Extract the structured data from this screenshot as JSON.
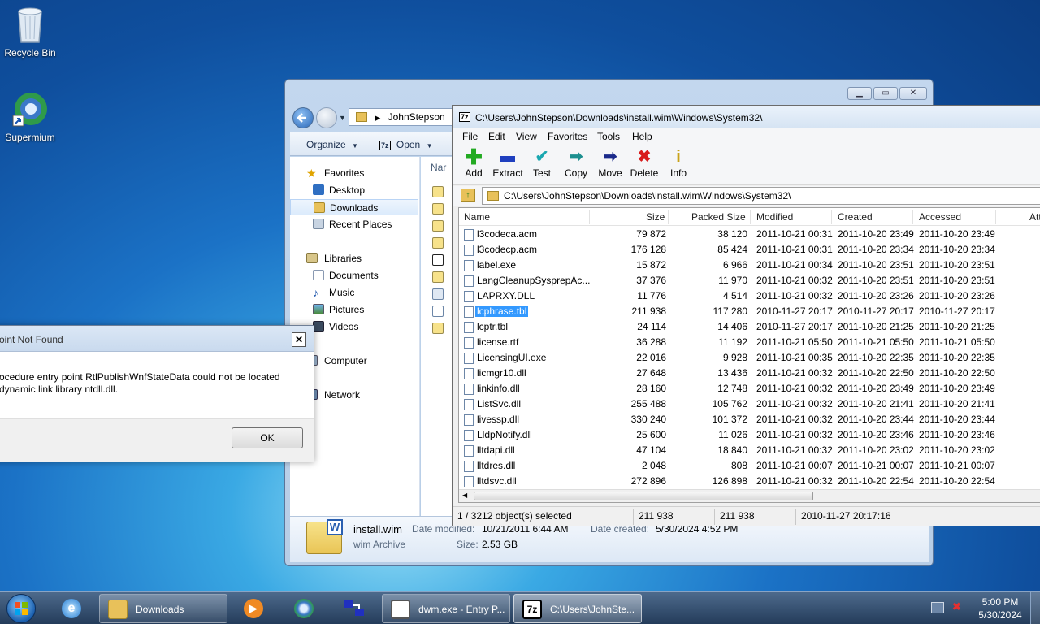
{
  "desktop": {
    "icons": [
      {
        "label": "Recycle Bin"
      },
      {
        "label": "Supermium"
      }
    ]
  },
  "explorer": {
    "breadcrumb": "JohnStepson",
    "toolbar": {
      "organize": "Organize",
      "open": "Open"
    },
    "nav": {
      "favorites": "Favorites",
      "desktop": "Desktop",
      "downloads": "Downloads",
      "recent": "Recent Places",
      "libraries": "Libraries",
      "documents": "Documents",
      "music": "Music",
      "pictures": "Pictures",
      "videos": "Videos",
      "computer": "Computer",
      "network": "Network"
    },
    "column_header_partial": "Nar",
    "details": {
      "file_name": "install.wim",
      "file_type": "wim Archive",
      "modified_label": "Date modified:",
      "modified_value": "10/21/2011 6:44 AM",
      "size_label": "Size:",
      "size_value": "2.53 GB",
      "created_label": "Date created:",
      "created_value": "5/30/2024 4:52 PM"
    }
  },
  "sevenzip": {
    "title": "C:\\Users\\JohnStepson\\Downloads\\install.wim\\Windows\\System32\\",
    "menu": [
      "File",
      "Edit",
      "View",
      "Favorites",
      "Tools",
      "Help"
    ],
    "tools": [
      {
        "label": "Add",
        "icon": "add-icon",
        "color": "#22aa22"
      },
      {
        "label": "Extract",
        "icon": "extract-icon",
        "color": "#1f3fbf"
      },
      {
        "label": "Test",
        "icon": "test-icon",
        "color": "#1aa7b0"
      },
      {
        "label": "Copy",
        "icon": "copy-icon",
        "color": "#1c8f8f"
      },
      {
        "label": "Move",
        "icon": "move-icon",
        "color": "#1a2a8a"
      },
      {
        "label": "Delete",
        "icon": "delete-icon",
        "color": "#d81b1b"
      },
      {
        "label": "Info",
        "icon": "info-icon",
        "color": "#c9a21a"
      }
    ],
    "address": "C:\\Users\\JohnStepson\\Downloads\\install.wim\\Windows\\System32\\",
    "columns": {
      "name": "Name",
      "size": "Size",
      "packed": "Packed Size",
      "modified": "Modified",
      "created": "Created",
      "accessed": "Accessed",
      "attr": "Att"
    },
    "files": [
      {
        "name": "l3codeca.acm",
        "size": "79 872",
        "packed": "38 120",
        "modified": "2011-10-21 00:31",
        "created": "2011-10-20 23:49",
        "accessed": "2011-10-20 23:49"
      },
      {
        "name": "l3codecp.acm",
        "size": "176 128",
        "packed": "85 424",
        "modified": "2011-10-21 00:31",
        "created": "2011-10-20 23:34",
        "accessed": "2011-10-20 23:34"
      },
      {
        "name": "label.exe",
        "size": "15 872",
        "packed": "6 966",
        "modified": "2011-10-21 00:34",
        "created": "2011-10-20 23:51",
        "accessed": "2011-10-20 23:51"
      },
      {
        "name": "LangCleanupSysprepAc...",
        "size": "37 376",
        "packed": "11 970",
        "modified": "2011-10-21 00:32",
        "created": "2011-10-20 23:51",
        "accessed": "2011-10-20 23:51"
      },
      {
        "name": "LAPRXY.DLL",
        "size": "11 776",
        "packed": "4 514",
        "modified": "2011-10-21 00:32",
        "created": "2011-10-20 23:26",
        "accessed": "2011-10-20 23:26"
      },
      {
        "name": "lcphrase.tbl",
        "size": "211 938",
        "packed": "117 280",
        "modified": "2010-11-27 20:17",
        "created": "2010-11-27 20:17",
        "accessed": "2010-11-27 20:17"
      },
      {
        "name": "lcptr.tbl",
        "size": "24 114",
        "packed": "14 406",
        "modified": "2010-11-27 20:17",
        "created": "2011-10-20 21:25",
        "accessed": "2011-10-20 21:25"
      },
      {
        "name": "license.rtf",
        "size": "36 288",
        "packed": "11 192",
        "modified": "2011-10-21 05:50",
        "created": "2011-10-21 05:50",
        "accessed": "2011-10-21 05:50"
      },
      {
        "name": "LicensingUI.exe",
        "size": "22 016",
        "packed": "9 928",
        "modified": "2011-10-21 00:35",
        "created": "2011-10-20 22:35",
        "accessed": "2011-10-20 22:35"
      },
      {
        "name": "licmgr10.dll",
        "size": "27 648",
        "packed": "13 436",
        "modified": "2011-10-21 00:32",
        "created": "2011-10-20 22:50",
        "accessed": "2011-10-20 22:50"
      },
      {
        "name": "linkinfo.dll",
        "size": "28 160",
        "packed": "12 748",
        "modified": "2011-10-21 00:32",
        "created": "2011-10-20 23:49",
        "accessed": "2011-10-20 23:49"
      },
      {
        "name": "ListSvc.dll",
        "size": "255 488",
        "packed": "105 762",
        "modified": "2011-10-21 00:32",
        "created": "2011-10-20 21:41",
        "accessed": "2011-10-20 21:41"
      },
      {
        "name": "livessp.dll",
        "size": "330 240",
        "packed": "101 372",
        "modified": "2011-10-21 00:32",
        "created": "2011-10-20 23:44",
        "accessed": "2011-10-20 23:44"
      },
      {
        "name": "LldpNotify.dll",
        "size": "25 600",
        "packed": "11 026",
        "modified": "2011-10-21 00:32",
        "created": "2011-10-20 23:46",
        "accessed": "2011-10-20 23:46"
      },
      {
        "name": "lltdapi.dll",
        "size": "47 104",
        "packed": "18 840",
        "modified": "2011-10-21 00:32",
        "created": "2011-10-20 23:02",
        "accessed": "2011-10-20 23:02"
      },
      {
        "name": "lltdres.dll",
        "size": "2 048",
        "packed": "808",
        "modified": "2011-10-21 00:07",
        "created": "2011-10-21 00:07",
        "accessed": "2011-10-21 00:07"
      },
      {
        "name": "lltdsvc.dll",
        "size": "272 896",
        "packed": "126 898",
        "modified": "2011-10-21 00:32",
        "created": "2011-10-20 22:54",
        "accessed": "2011-10-20 22:54"
      }
    ],
    "status": {
      "selection": "1 / 3212 object(s) selected",
      "size": "211 938",
      "packed": "211 938",
      "date": "2010-11-27 20:17:16"
    }
  },
  "dialog": {
    "title": "oint Not Found",
    "line1": "ocedure entry point RtlPublishWnfStateData could not be located",
    "line2": "dynamic link library ntdll.dll.",
    "ok": "OK",
    "close": "✕"
  },
  "taskbar": {
    "items": [
      {
        "label": "Downloads"
      },
      {
        "label": "dwm.exe - Entry P..."
      },
      {
        "label": "C:\\Users\\JohnSte..."
      }
    ],
    "clock_time": "5:00 PM",
    "clock_date": "5/30/2024"
  }
}
